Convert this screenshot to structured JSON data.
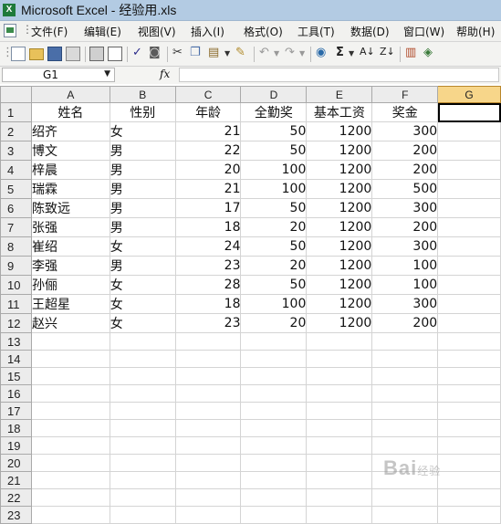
{
  "window": {
    "title": "Microsoft Excel - 经验用.xls"
  },
  "menu": {
    "items": [
      "文件(F)",
      "编辑(E)",
      "视图(V)",
      "插入(I)",
      "格式(O)",
      "工具(T)",
      "数据(D)",
      "窗口(W)",
      "帮助(H)"
    ]
  },
  "toolbar": {
    "icons": [
      "new-icon",
      "open-icon",
      "save-icon",
      "permission-icon",
      "email-icon",
      "print-icon",
      "print-preview-icon",
      "spelling-icon",
      "research-icon",
      "cut-icon",
      "copy-icon",
      "paste-icon",
      "format-painter-icon",
      "undo-icon",
      "redo-icon",
      "hyperlink-icon",
      "autosum-icon",
      "sort-ascending-icon",
      "sort-descending-icon",
      "chart-wizard-icon",
      "drawing-icon"
    ]
  },
  "formula_bar": {
    "name_box": "G1",
    "fx_label": "fx",
    "formula": ""
  },
  "sheet": {
    "columns": [
      "A",
      "B",
      "C",
      "D",
      "E",
      "F",
      "G"
    ],
    "row_numbers": [
      "1",
      "2",
      "3",
      "4",
      "5",
      "6",
      "7",
      "8",
      "9",
      "10",
      "11",
      "12",
      "13",
      "14",
      "15",
      "16",
      "17",
      "18",
      "19",
      "20",
      "21",
      "22",
      "23"
    ],
    "header_row": [
      "姓名",
      "性别",
      "年龄",
      "全勤奖",
      "基本工资",
      "奖金",
      ""
    ],
    "rows": [
      [
        "绍齐",
        "女",
        "21",
        "50",
        "1200",
        "300"
      ],
      [
        "博文",
        "男",
        "22",
        "50",
        "1200",
        "200"
      ],
      [
        "梓晨",
        "男",
        "20",
        "100",
        "1200",
        "200"
      ],
      [
        "瑞霖",
        "男",
        "21",
        "100",
        "1200",
        "500"
      ],
      [
        "陈致远",
        "男",
        "17",
        "50",
        "1200",
        "300"
      ],
      [
        "张强",
        "男",
        "18",
        "20",
        "1200",
        "200"
      ],
      [
        "崔绍",
        "女",
        "24",
        "50",
        "1200",
        "300"
      ],
      [
        "李强",
        "男",
        "23",
        "20",
        "1200",
        "100"
      ],
      [
        "孙俪",
        "女",
        "28",
        "50",
        "1200",
        "100"
      ],
      [
        "王超星",
        "女",
        "18",
        "100",
        "1200",
        "300"
      ],
      [
        "赵兴",
        "女",
        "23",
        "20",
        "1200",
        "200"
      ]
    ],
    "selected_cell": "G1"
  },
  "watermark": {
    "text": "Bai",
    "sub": "经验"
  },
  "colors": {
    "title_bar": "#b3cbe3",
    "selected_header": "#f7d68a",
    "header_bg": "#ececec",
    "gridline": "#d4d4d4"
  }
}
